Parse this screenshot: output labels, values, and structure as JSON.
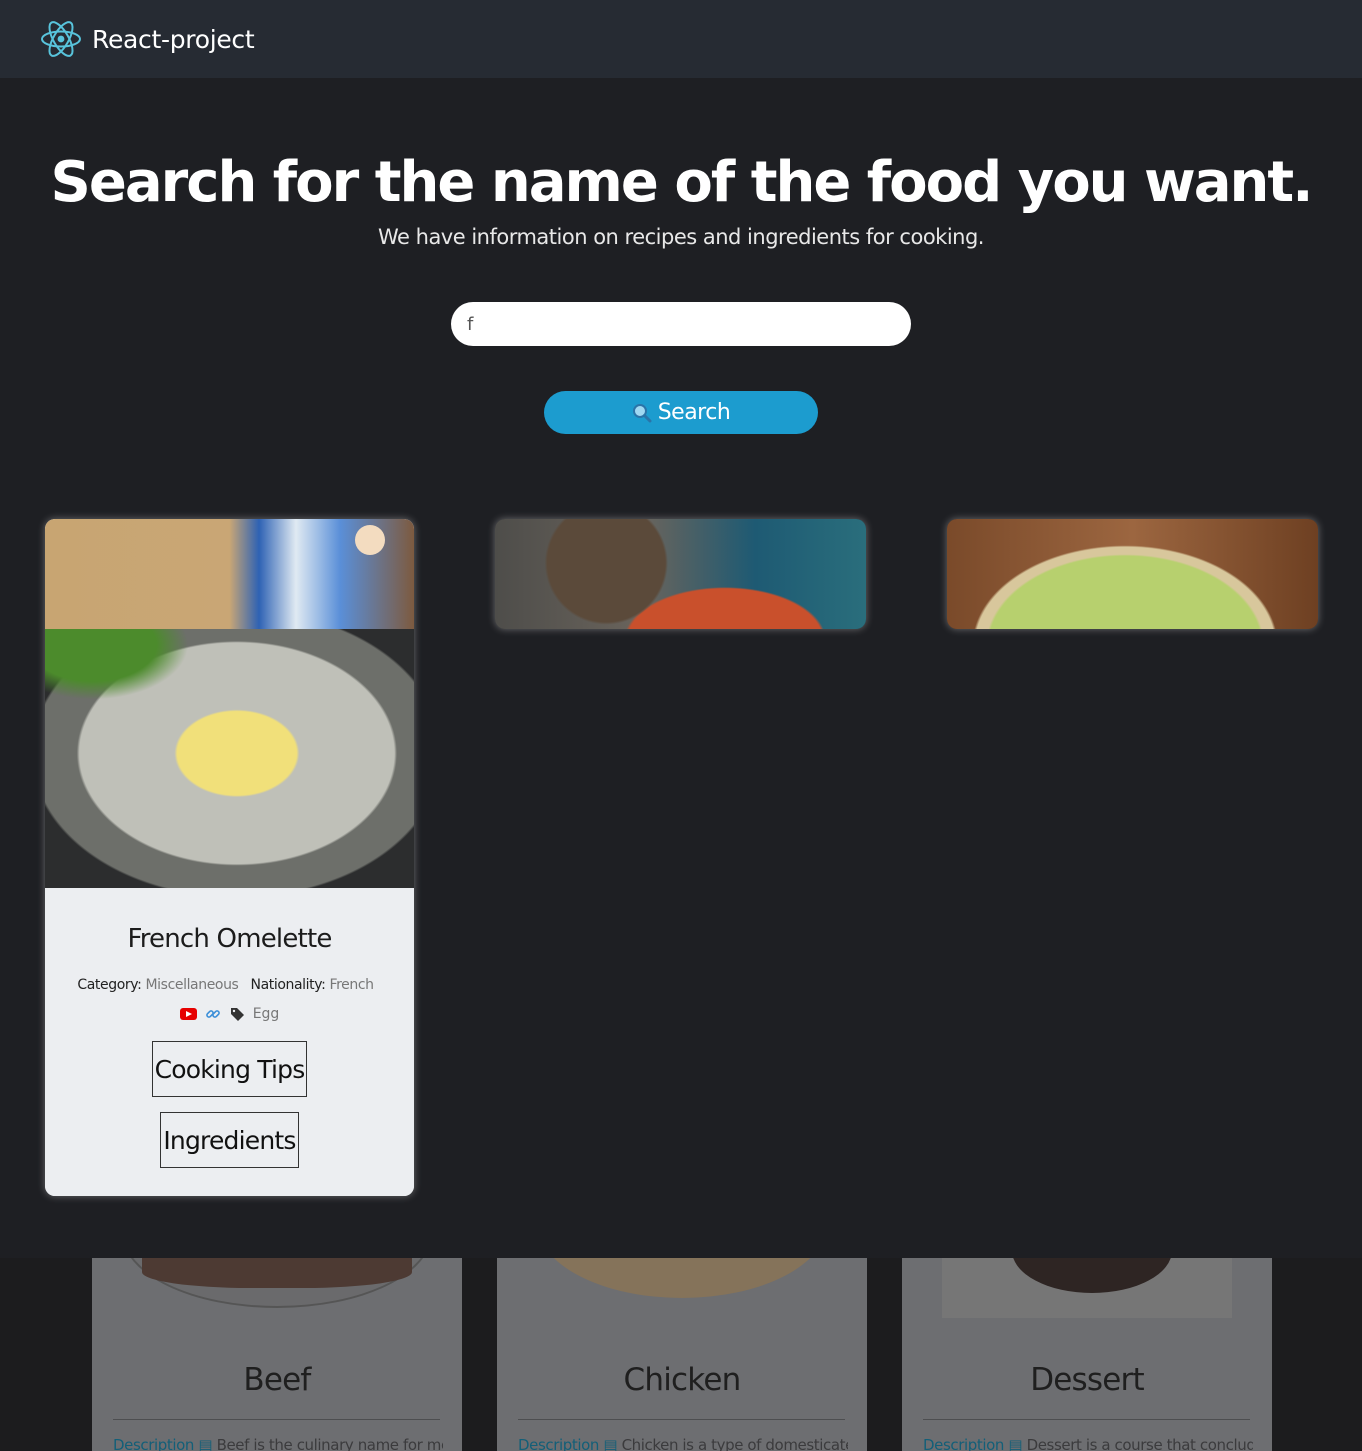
{
  "navbar": {
    "brand_title": "React-project",
    "brand_icon": "react-atom-icon",
    "accent_color": "#58c4dc"
  },
  "hero": {
    "title": "Search for the name of the food you want.",
    "subtitle": "We have information on recipes and ingredients for cooking."
  },
  "search": {
    "value": "f",
    "placeholder": "",
    "button_label": "Search",
    "button_icon": "magnifier-icon",
    "button_color": "#1c9ccf"
  },
  "meal_card": {
    "title": "French Omelette",
    "category_label": "Category:",
    "category_value": "Miscellaneous",
    "nationality_label": "Nationality:",
    "nationality_value": "French",
    "tag": "Egg",
    "icons": [
      "youtube-icon",
      "link-icon",
      "tag-icon"
    ],
    "cooking_tips_label": "Cooking Tips",
    "ingredients_label": "Ingredients"
  },
  "categories": [
    {
      "name": "Beef",
      "desc_link": "Description",
      "desc_text": "Beef is the culinary name for meat"
    },
    {
      "name": "Chicken",
      "desc_link": "Description",
      "desc_text": "Chicken is a type of domesticated"
    },
    {
      "name": "Dessert",
      "desc_link": "Description",
      "desc_text": "Dessert is a course that concludes a"
    }
  ]
}
